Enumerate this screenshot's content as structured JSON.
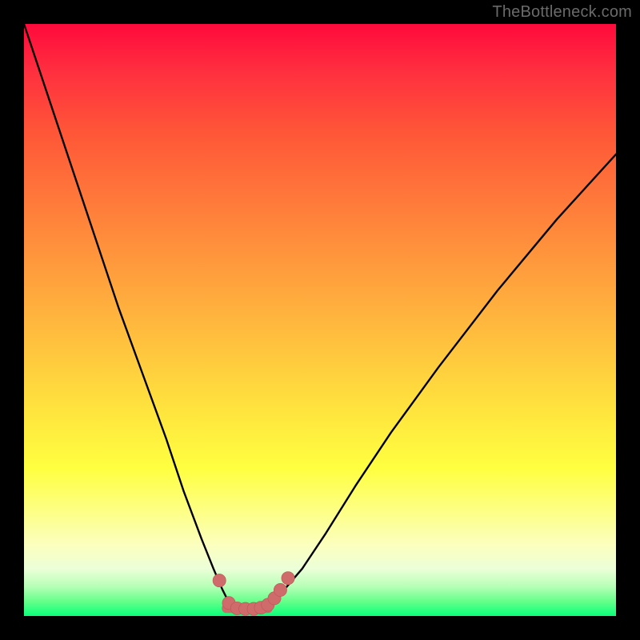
{
  "watermark": {
    "text": "TheBottleneck.com"
  },
  "colors": {
    "curve": "#000000",
    "marker_fill": "#cf6b6b",
    "marker_stroke": "#b95757"
  },
  "chart_data": {
    "type": "line",
    "title": "",
    "xlabel": "",
    "ylabel": "",
    "xlim": [
      0,
      100
    ],
    "ylim": [
      0,
      100
    ],
    "grid": false,
    "legend": false,
    "series": [
      {
        "name": "left-branch",
        "x": [
          0,
          4,
          8,
          12,
          16,
          20,
          24,
          27,
          30,
          32,
          33.5,
          34.5,
          35.5
        ],
        "y": [
          100,
          88,
          76,
          64,
          52,
          41,
          30,
          21,
          13,
          8,
          4.5,
          2.5,
          1.5
        ]
      },
      {
        "name": "floor",
        "x": [
          35.5,
          37,
          38.5,
          40,
          41,
          42
        ],
        "y": [
          1.5,
          1.2,
          1.2,
          1.4,
          1.8,
          2.5
        ]
      },
      {
        "name": "right-branch",
        "x": [
          42,
          44,
          47,
          51,
          56,
          62,
          70,
          80,
          90,
          100
        ],
        "y": [
          2.5,
          4.5,
          8,
          14,
          22,
          31,
          42,
          55,
          67,
          78
        ]
      }
    ],
    "markers": {
      "name": "highlight-dots",
      "points": [
        {
          "x": 33.0,
          "y": 6.0,
          "r": 1.1
        },
        {
          "x": 34.6,
          "y": 2.2,
          "r": 1.1
        },
        {
          "x": 36.0,
          "y": 1.3,
          "r": 1.1
        },
        {
          "x": 37.4,
          "y": 1.2,
          "r": 1.1
        },
        {
          "x": 38.8,
          "y": 1.2,
          "r": 1.1
        },
        {
          "x": 40.0,
          "y": 1.4,
          "r": 1.1
        },
        {
          "x": 41.2,
          "y": 1.9,
          "r": 1.1
        },
        {
          "x": 42.3,
          "y": 3.0,
          "r": 1.1
        },
        {
          "x": 43.3,
          "y": 4.4,
          "r": 1.1
        },
        {
          "x": 44.6,
          "y": 6.4,
          "r": 1.1
        }
      ]
    },
    "highlight_band": {
      "name": "floor-bar",
      "x0": 34.2,
      "x1": 41.2,
      "y": 1.3,
      "thickness": 1.6
    }
  }
}
